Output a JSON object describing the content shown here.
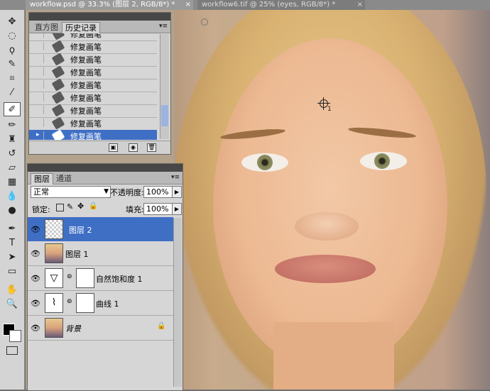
{
  "doc_tabs": [
    {
      "title": "workflow.psd @ 33.3% (图层 2, RGB/8*) *",
      "close": "×"
    },
    {
      "title": "workflow6.tif @ 25% (eyes, RGB/8*) *",
      "close": "×"
    }
  ],
  "history_panel": {
    "tabs": [
      "直方图",
      "历史记录"
    ],
    "items": [
      "修复画笔",
      "修复画笔",
      "修复画笔",
      "修复画笔",
      "修复画笔",
      "修复画笔",
      "修复画笔",
      "修复画笔",
      "修复画笔"
    ],
    "selected_index": 8
  },
  "layers_panel": {
    "tabs": [
      "图层",
      "通道"
    ],
    "blend_mode": "正常",
    "opacity_label": "不透明度:",
    "opacity_value": "100%",
    "lock_label": "锁定:",
    "fill_label": "填充:",
    "fill_value": "100%",
    "layers": [
      {
        "name": "图层 2",
        "selected": true
      },
      {
        "name": "图层 1",
        "selected": false
      },
      {
        "name": "自然饱和度 1",
        "selected": false
      },
      {
        "name": "曲线 1",
        "selected": false
      },
      {
        "name": "背景",
        "selected": false
      }
    ]
  },
  "cursor_label": "1",
  "colors": {
    "selection": "#3f6fc5",
    "panel": "#d6d6d6"
  }
}
